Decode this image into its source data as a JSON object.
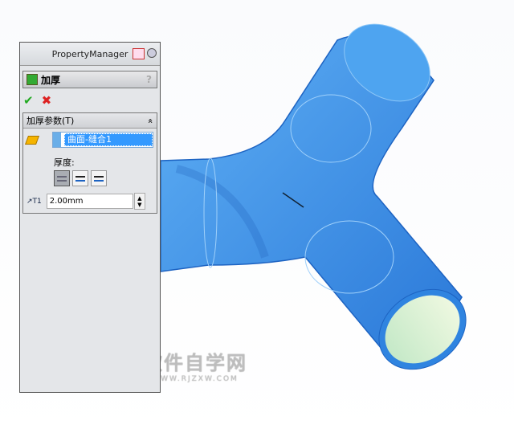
{
  "property_manager": {
    "title": "PropertyManager",
    "feature_name": "加厚",
    "help": "?",
    "ok": "✔",
    "cancel": "✖",
    "group_title": "加厚参数(T)",
    "collapse": "«",
    "selected_face": "曲面-缝合1",
    "thickness_label": "厚度:",
    "thickness_value": "2.00mm",
    "spin_up": "▲",
    "spin_down": "▼"
  },
  "watermark": {
    "title": "软件自学网",
    "url": "WWW.RJZXW.COM"
  },
  "colors": {
    "model": "#3a8fe8",
    "model_dark": "#1d63c2",
    "inner": "#d8f0d4",
    "selection": "#3399ff"
  }
}
